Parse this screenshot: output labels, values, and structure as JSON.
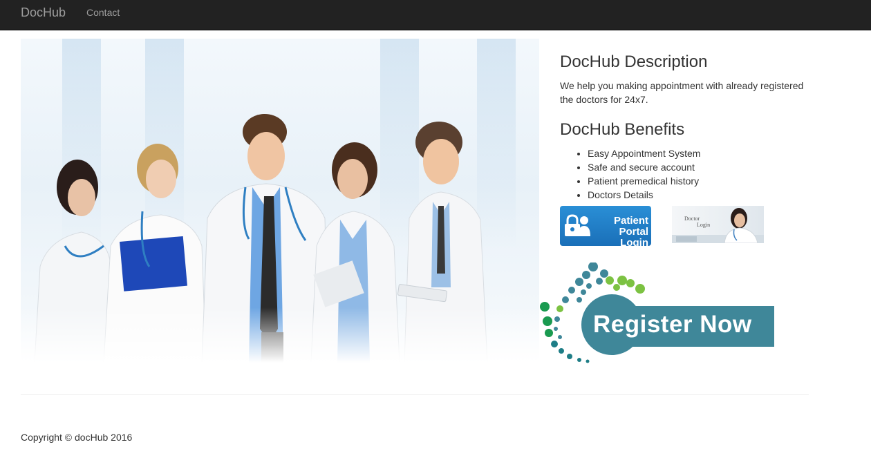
{
  "navbar": {
    "brand": "DocHub",
    "links": [
      {
        "label": "Contact"
      }
    ]
  },
  "hero_image": {
    "alt": "Team of smiling doctors"
  },
  "description": {
    "title": "DocHub Description",
    "text": "We help you making appointment with already registered the doctors for 24x7."
  },
  "benefits": {
    "title": "DocHub Benefits",
    "items": [
      "Easy Appointment System",
      "Safe and secure account",
      "Patient premedical history",
      "Doctors Details"
    ]
  },
  "login_buttons": {
    "patient_line1": "Patient",
    "patient_line2": "Portal Login",
    "doctor_line1": "Doctor",
    "doctor_line2": "Login"
  },
  "register": {
    "label": "Register Now"
  },
  "footer": {
    "copyright": "Copyright © docHub 2016"
  },
  "colors": {
    "navbar_bg": "#222222",
    "nav_text": "#9d9d9d",
    "register_teal": "#3f8799",
    "patient_blue": "#1f7bc4",
    "dot_green": "#7cc242"
  },
  "icons": [
    "lock-user-icon",
    "doctor-portrait-icon",
    "dotted-arc-icon"
  ]
}
